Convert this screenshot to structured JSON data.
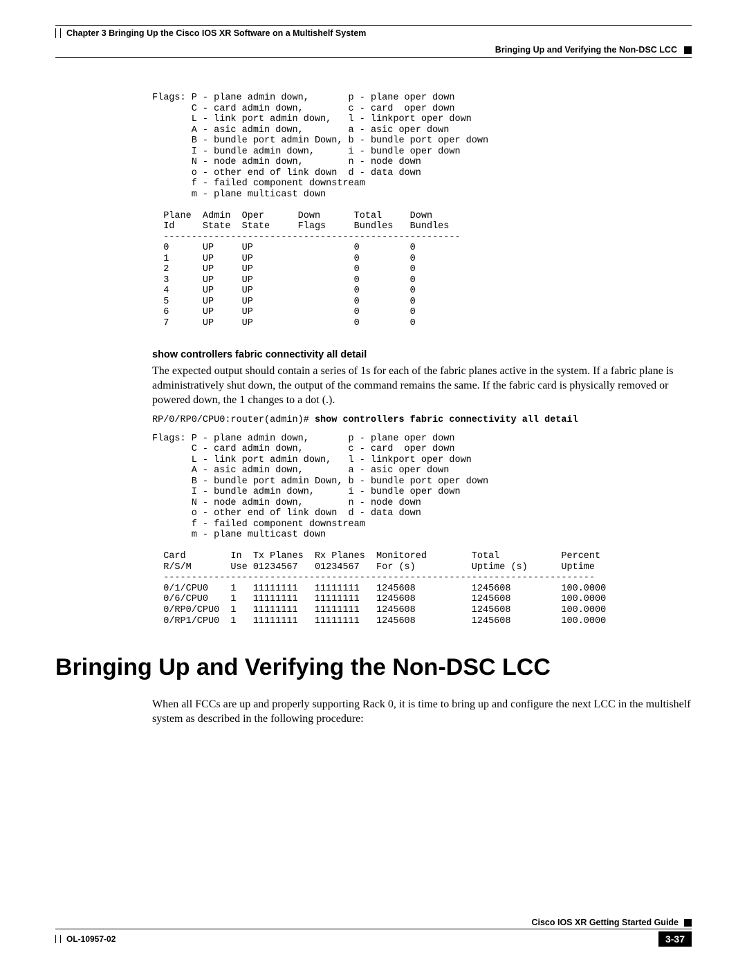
{
  "header": {
    "chapter": "Chapter 3    Bringing Up the Cisco IOS XR Software on a Multishelf System",
    "section": "Bringing Up and Verifying the Non-DSC LCC"
  },
  "block1": {
    "flags": "Flags: P - plane admin down,       p - plane oper down\n       C - card admin down,        c - card  oper down\n       L - link port admin down,   l - linkport oper down\n       A - asic admin down,        a - asic oper down\n       B - bundle port admin Down, b - bundle port oper down\n       I - bundle admin down,      i - bundle oper down\n       N - node admin down,        n - node down\n       o - other end of link down  d - data down\n       f - failed component downstream\n       m - plane multicast down",
    "table": "  Plane  Admin  Oper      Down      Total     Down   \n  Id     State  State     Flags     Bundles   Bundles\n  -----------------------------------------------------\n  0      UP     UP                  0         0     \n  1      UP     UP                  0         0     \n  2      UP     UP                  0         0     \n  3      UP     UP                  0         0     \n  4      UP     UP                  0         0     \n  5      UP     UP                  0         0     \n  6      UP     UP                  0         0     \n  7      UP     UP                  0         0     "
  },
  "section2": {
    "heading": "show controllers fabric connectivity all detail",
    "para": "The expected output should contain a series of 1s for each of the fabric planes active in the system. If a fabric plane is administratively shut down, the output of the command remains the same. If the fabric card is physically removed or powered down, the 1 changes to a dot (.).",
    "prompt": "RP/0/RP0/CPU0:router(admin)# ",
    "command": "show controllers fabric connectivity all detail",
    "flags": "Flags: P - plane admin down,       p - plane oper down\n       C - card admin down,        c - card  oper down\n       L - link port admin down,   l - linkport oper down\n       A - asic admin down,        a - asic oper down\n       B - bundle port admin Down, b - bundle port oper down\n       I - bundle admin down,      i - bundle oper down\n       N - node admin down,        n - node down\n       o - other end of link down  d - data down\n       f - failed component downstream\n       m - plane multicast down",
    "table": "  Card        In  Tx Planes  Rx Planes  Monitored        Total           Percent\n  R/S/M       Use 01234567   01234567   For (s)          Uptime (s)      Uptime\n  -----------------------------------------------------------------------------\n  0/1/CPU0    1   11111111   11111111   1245608          1245608         100.0000\n  0/6/CPU0    1   11111111   11111111   1245608          1245608         100.0000\n  0/RP0/CPU0  1   11111111   11111111   1245608          1245608         100.0000\n  0/RP1/CPU0  1   11111111   11111111   1245608          1245608         100.0000"
  },
  "bigHeading": "Bringing Up and Verifying the Non-DSC LCC",
  "closingPara": "When all FCCs are up and properly supporting Rack 0, it is time to bring up and configure the next LCC in the multishelf system as described in the following procedure:",
  "footer": {
    "guide": "Cisco IOS XR Getting Started Guide",
    "docId": "OL-10957-02",
    "pageNum": "3-37"
  },
  "chart_data": [
    {
      "type": "table",
      "title": "Plane State Summary",
      "columns": [
        "Plane Id",
        "Admin State",
        "Oper State",
        "Down Flags",
        "Total Bundles",
        "Down Bundles"
      ],
      "rows": [
        [
          "0",
          "UP",
          "UP",
          "",
          0,
          0
        ],
        [
          "1",
          "UP",
          "UP",
          "",
          0,
          0
        ],
        [
          "2",
          "UP",
          "UP",
          "",
          0,
          0
        ],
        [
          "3",
          "UP",
          "UP",
          "",
          0,
          0
        ],
        [
          "4",
          "UP",
          "UP",
          "",
          0,
          0
        ],
        [
          "5",
          "UP",
          "UP",
          "",
          0,
          0
        ],
        [
          "6",
          "UP",
          "UP",
          "",
          0,
          0
        ],
        [
          "7",
          "UP",
          "UP",
          "",
          0,
          0
        ]
      ]
    },
    {
      "type": "table",
      "title": "Fabric Connectivity Detail",
      "columns": [
        "Card R/S/M",
        "In Use",
        "Tx Planes 01234567",
        "Rx Planes 01234567",
        "Monitored For (s)",
        "Total Uptime (s)",
        "Percent Uptime"
      ],
      "rows": [
        [
          "0/1/CPU0",
          1,
          "11111111",
          "11111111",
          1245608,
          1245608,
          100.0
        ],
        [
          "0/6/CPU0",
          1,
          "11111111",
          "11111111",
          1245608,
          1245608,
          100.0
        ],
        [
          "0/RP0/CPU0",
          1,
          "11111111",
          "11111111",
          1245608,
          1245608,
          100.0
        ],
        [
          "0/RP1/CPU0",
          1,
          "11111111",
          "11111111",
          1245608,
          1245608,
          100.0
        ]
      ]
    }
  ]
}
